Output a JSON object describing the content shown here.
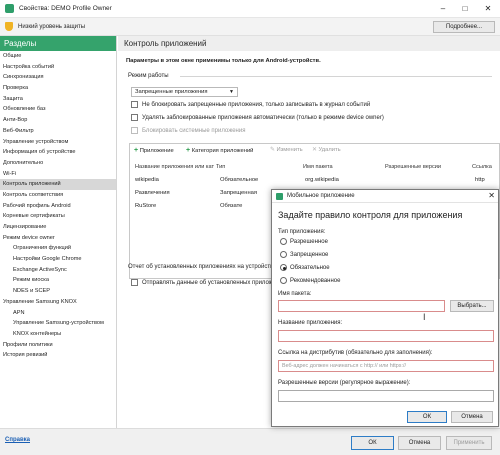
{
  "window": {
    "title": "Свойства: DEMO Profile Owner",
    "security_level": "Низкий уровень защиты",
    "details_button": "Подробнее..."
  },
  "sidebar": {
    "header": "Разделы",
    "items": [
      {
        "label": "Общие"
      },
      {
        "label": "Настройка событий"
      },
      {
        "label": "Синхронизация"
      },
      {
        "label": "Проверка"
      },
      {
        "label": "Защита"
      },
      {
        "label": "Обновление баз"
      },
      {
        "label": "Анти-Вор"
      },
      {
        "label": "Веб-Фильтр"
      },
      {
        "label": "Управление устройством"
      },
      {
        "label": "Информация об устройстве"
      },
      {
        "label": "Дополнительно"
      },
      {
        "label": "Wi-Fi"
      },
      {
        "label": "Контроль приложений"
      },
      {
        "label": "Контроль соответствия"
      },
      {
        "label": "Рабочий профиль Android"
      },
      {
        "label": "Корневые сертификаты"
      },
      {
        "label": "Лицензирование"
      },
      {
        "label": "Режим device owner"
      },
      {
        "label": "Ограничения функций"
      },
      {
        "label": "Настройки Google Chrome"
      },
      {
        "label": "Exchange ActiveSync"
      },
      {
        "label": "Режим киоска"
      },
      {
        "label": "NDES и SCEP"
      },
      {
        "label": "Управление Samsung KNOX"
      },
      {
        "label": "APN"
      },
      {
        "label": "Управление Samsung-устройством"
      },
      {
        "label": "KNOX контейнеры"
      },
      {
        "label": "Профили политики"
      },
      {
        "label": "История ревизий"
      }
    ]
  },
  "main": {
    "heading": "Контроль приложений",
    "android_only_note": "Параметры в этом окне применимы только для Android-устройств.",
    "mode_group": "Режим работы",
    "mode_value": "Запрещенные приложения",
    "cb_no_block": "Не блокировать запрещенные приложения, только записывать в журнал событий",
    "cb_remove_blocked": "Удалять заблокированные приложения автоматически (только в режиме device owner)",
    "cb_block_system": "Блокировать системные приложения",
    "toolbar": {
      "add_app": "Приложение",
      "add_category": "Категория приложений",
      "edit": "Изменить",
      "delete": "Удалить"
    },
    "table": {
      "columns": [
        "Название приложения или кат",
        "Тип",
        "Имя пакета",
        "Разрешенные версии",
        "Ссылка"
      ],
      "rows": [
        [
          "wikipedia",
          "Обязательное",
          "org.wikipedia",
          "",
          "http"
        ],
        [
          "Развлечения",
          "Запрещенная",
          "",
          "",
          ""
        ],
        [
          "RuStore",
          "Обязате",
          "",
          "",
          ""
        ]
      ]
    },
    "report_group": "Отчет об установленных приложениях на устройств",
    "cb_send_data": "Отправлять данные об установленных приложениях на"
  },
  "dialog": {
    "title": "Мобильное приложение",
    "heading": "Задайте правило контроля для приложения",
    "type_label": "Тип приложения:",
    "types": [
      "Разрешенное",
      "Запрещенное",
      "Обязательное",
      "Рекомендованное"
    ],
    "selected_type": "Обязательное",
    "package_label": "Имя пакета:",
    "package_value": "",
    "browse_button": "Выбрать...",
    "app_name_label": "Название приложения:",
    "app_name_value": "",
    "link_label": "Ссылка на дистрибутив (обязательно для заполнения):",
    "link_placeholder": "Веб-адрес должен начинаться с http:// или https://",
    "versions_label": "Разрешенные версии (регулярное выражение):",
    "ok": "ОК",
    "cancel": "Отмена"
  },
  "footer": {
    "help": "Справка",
    "ok": "ОК",
    "cancel": "Отмена",
    "apply": "Применить"
  },
  "colors": {
    "accent_green": "#35a36c",
    "warning_yellow": "#f0b323",
    "link_blue": "#1a5fb4",
    "invalid_border": "#d98c8c"
  }
}
